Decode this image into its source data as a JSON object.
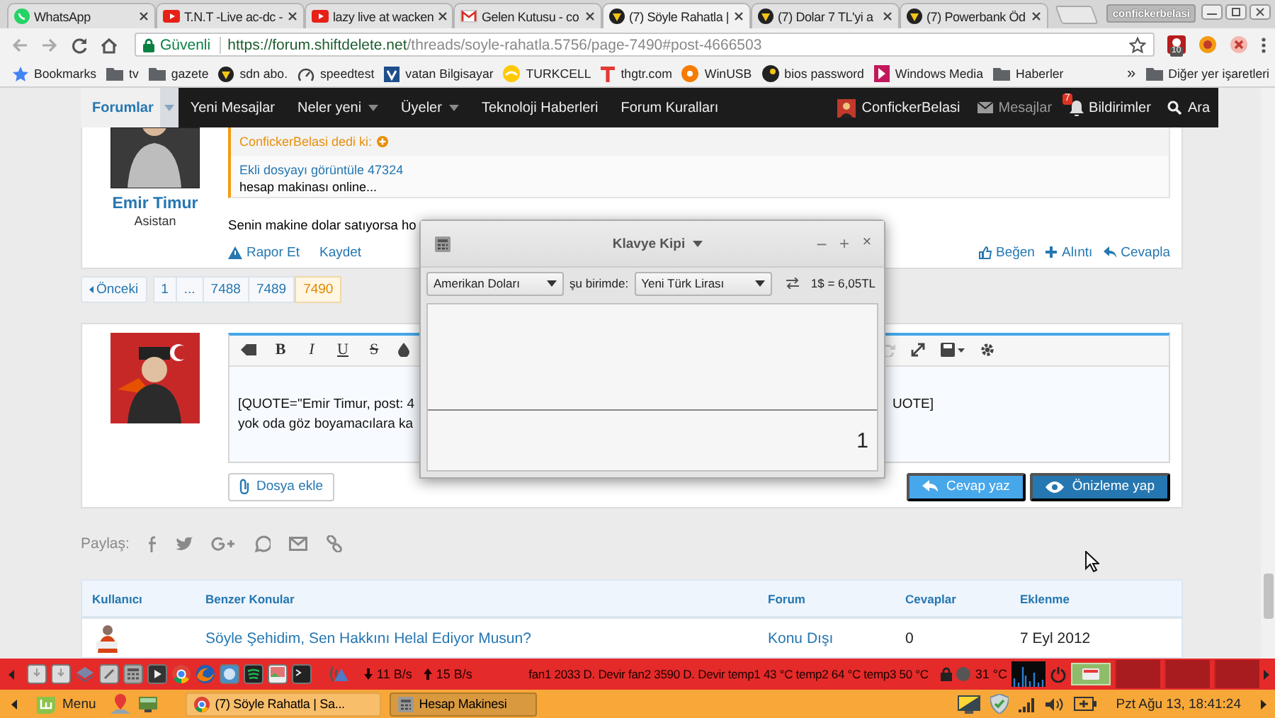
{
  "browser": {
    "tabs": [
      {
        "title": "WhatsApp",
        "kind": "whatsapp",
        "selected": false
      },
      {
        "title": "T.N.T -Live ac-dc -",
        "kind": "youtube",
        "selected": false
      },
      {
        "title": "lazy live at wacken",
        "kind": "youtube",
        "selected": false
      },
      {
        "title": "Gelen Kutusu - co",
        "kind": "gmail",
        "selected": false
      },
      {
        "title": "(7) Söyle Rahatla |",
        "kind": "forum",
        "selected": true
      },
      {
        "title": "(7) Dolar 7 TL'yi a",
        "kind": "forum",
        "selected": false
      },
      {
        "title": "(7) Powerbank Öd",
        "kind": "forum",
        "selected": false
      }
    ],
    "profile": "confickerbelasi",
    "address": {
      "security": "Güvenli",
      "host": "https://forum.shiftdelete.net",
      "path": "/threads/soyle-rahatla.5756/page-7490#post-4666503"
    },
    "extension_badge": "10",
    "bookmarks": [
      {
        "label": "Bookmarks",
        "kind": "star"
      },
      {
        "label": "tv",
        "kind": "folder"
      },
      {
        "label": "gazete",
        "kind": "folder"
      },
      {
        "label": "sdn abo.",
        "kind": "forum"
      },
      {
        "label": "speedtest",
        "kind": "gauge"
      },
      {
        "label": "vatan Bilgisayar",
        "kind": "square"
      },
      {
        "label": "TURKCELL",
        "kind": "swirl"
      },
      {
        "label": "thgtr.com",
        "kind": "tlogo"
      },
      {
        "label": "WinUSB",
        "kind": "orange"
      },
      {
        "label": "bios password",
        "kind": "dark"
      },
      {
        "label": "Windows Media",
        "kind": "media"
      },
      {
        "label": "Haberler",
        "kind": "folder"
      }
    ],
    "more_bookmarks": "»",
    "other_bookmarks": "Diğer yer işaretleri"
  },
  "forum_nav": {
    "items": [
      {
        "label": "Forumlar",
        "selected": true,
        "dropdown": true
      },
      {
        "label": "Yeni Mesajlar",
        "selected": false,
        "dropdown": false
      },
      {
        "label": "Neler yeni",
        "selected": false,
        "dropdown": true
      },
      {
        "label": "Üyeler",
        "selected": false,
        "dropdown": true
      },
      {
        "label": "Teknoloji Haberleri",
        "selected": false,
        "dropdown": false
      },
      {
        "label": "Forum Kuralları",
        "selected": false,
        "dropdown": false
      }
    ],
    "user": "ConfickerBelasi",
    "messages": "Mesajlar",
    "notification_count": "7",
    "notifications": "Bildirimler",
    "search": "Ara"
  },
  "post": {
    "author": "Emir Timur",
    "role": "Asistan",
    "quote_author": "ConfickerBelasi dedi ki:",
    "quote_link": "Ekli dosyayı görüntüle 47324",
    "quote_text": "hesap makinası online...",
    "message": "Senin makine dolar satıyorsa ho",
    "actions_left": [
      {
        "label": "Rapor Et",
        "kind": "report"
      },
      {
        "label": "Kaydet",
        "kind": "plain"
      }
    ],
    "actions_right": [
      {
        "label": "Beğen",
        "kind": "like"
      },
      {
        "label": "Alıntı",
        "kind": "quote"
      },
      {
        "label": "Cevapla",
        "kind": "reply"
      }
    ]
  },
  "pagination": {
    "previous": "Önceki",
    "pages": [
      {
        "label": "1",
        "selected": false
      },
      {
        "label": "...",
        "selected": false
      },
      {
        "label": "7488",
        "selected": false
      },
      {
        "label": "7489",
        "selected": false
      },
      {
        "label": "7490",
        "selected": true
      }
    ]
  },
  "reply": {
    "format_buttons": [
      {
        "label": "B",
        "kind": "bold"
      },
      {
        "label": "I",
        "kind": "italic"
      },
      {
        "label": "U",
        "kind": "underline"
      },
      {
        "label": "S",
        "kind": "strike"
      }
    ],
    "lines": [
      "[QUOTE=\"Emir Timur, post: 4",
      "yok oda göz boyamacılara ka"
    ],
    "line_end": "UOTE]",
    "attach": "Dosya ekle",
    "submit": "Cevap yaz",
    "preview": "Önizleme yap"
  },
  "share": {
    "label": "Paylaş:"
  },
  "similar": {
    "columns": [
      "Kullanıcı",
      "Benzer Konular",
      "Forum",
      "Cevaplar",
      "Eklenme"
    ],
    "rows": [
      {
        "title": "Söyle Şehidim, Sen Hakkını Helal Ediyor Musun?",
        "forum": "Konu Dışı",
        "replies": "0",
        "date": "7 Eyl 2012"
      }
    ]
  },
  "calculator": {
    "title": "Klavye Kipi",
    "controls": [
      {
        "label": "−",
        "kind": "minimize"
      },
      {
        "label": "+",
        "kind": "maximize"
      },
      {
        "label": "×",
        "kind": "close"
      }
    ],
    "from": "Amerikan Doları",
    "to_label": "şu birimde:",
    "to": "Yeni Türk Lirası",
    "rate": "1$ = 6,05TL",
    "display": "1"
  },
  "panel": {
    "download": "11 B/s",
    "upload": "15 B/s",
    "sensors": "fan1 2033 D. Devir fan2 3590 D. Devir temp1 43 °C temp2 64 °C temp3 50 °C",
    "cpu_temp": "31 °C"
  },
  "taskbar": {
    "menu": "Menu",
    "windows": [
      {
        "title": "(7) Söyle Rahatla | Sa...",
        "kind": "browser",
        "selected": false
      },
      {
        "title": "Hesap Makinesi",
        "kind": "calculator",
        "selected": true
      }
    ],
    "clock": "Pzt Ağu 13, 18:41:24"
  }
}
